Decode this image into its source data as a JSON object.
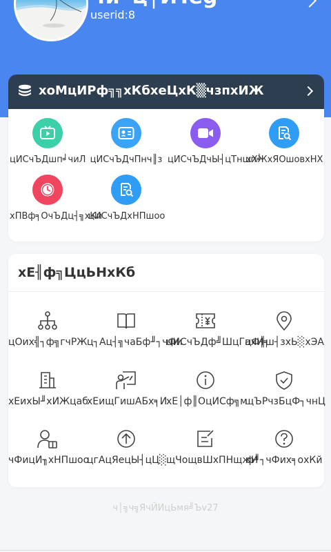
{
  "profile": {
    "username": "чи╜ц│ЙTeg",
    "userid": "userid:8"
  },
  "task_banner": {
    "label": "хоМцИРф╗╗хКбхеЦхК▒чзпхИЖ"
  },
  "shortcuts": [
    {
      "label": "цИСчЪДшп╛чиЛ",
      "icon": "video-play-icon",
      "color": "#3ccfa8"
    },
    {
      "label": "цИСчЪДчПнч║з",
      "icon": "id-card-icon",
      "color": "#3aa3f5"
    },
    {
      "label": "цИСчЪДчЫ┤цТншп╛",
      "icon": "video-camera-icon",
      "color": "#8b5cf0"
    },
    {
      "label": "хХЖхЯОшовхНХ",
      "icon": "document-search-icon",
      "color": "#2f9cf5"
    },
    {
      "label": "хПВф╕ОчЪДц┤╗хКи",
      "icon": "clock-icon",
      "color": "#f0455e"
    },
    {
      "label": "цИСчЪДхНПшоо",
      "icon": "document-search-icon",
      "color": "#2f9cf5"
    }
  ],
  "other_services": {
    "title": "хЕ╢ф╗ЦцЬНхКб",
    "items": [
      {
        "label": "цОих╣┐ф╗гчРЖ",
        "icon": "hierarchy-icon"
      },
      {
        "label": "ц┐Ац┤╗чаБф╜┐чФи",
        "icon": "book-icon"
      },
      {
        "label": "цИСчЪДф╝ШцГахИ╕",
        "icon": "coupon-icon"
      },
      {
        "label": "цФ╢ш┤зхЬ░хЭА",
        "icon": "location-pin-icon"
      },
      {
        "label": "хЕихЫ╜хИЖцаб",
        "icon": "building-icon"
      },
      {
        "label": "хЕищГишАБх╕И",
        "icon": "teacher-icon"
      },
      {
        "label": "хЕ│ф║ОцИСф╗м",
        "icon": "info-icon"
      },
      {
        "label": "щЪРчзБцФ┐чнЦ",
        "icon": "shield-check-icon"
      },
      {
        "label": "чФицИ╖хНПшоо",
        "icon": "user-agreement-icon"
      },
      {
        "label": "цгАцЯецЫ┤цЦ░",
        "icon": "arrow-up-circle-icon"
      },
      {
        "label": "щЧощвШхПНщжИ",
        "icon": "feedback-icon"
      },
      {
        "label": "ф╜┐чФих╕охКй",
        "icon": "question-icon"
      }
    ]
  },
  "footer": {
    "version_text": "ч│╗ч╗ЯчЙИцЬмя╝Ъv27"
  },
  "colors": {
    "header_blue": "#4a86ef",
    "banner_dark": "#2d3e50",
    "page_bg": "#f5f6f8"
  }
}
